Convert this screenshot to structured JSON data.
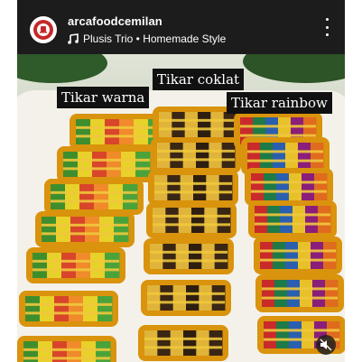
{
  "post": {
    "username": "arcafoodcemilan",
    "audio": "Plusis Trio • Homemade Style"
  },
  "captions": {
    "warna": "Tikar warna",
    "coklat": "Tikar coklat",
    "rainbow": "Tikar rainbow"
  },
  "icons": {
    "avatar": "restaurant-logo-icon",
    "music": "music-note-icon",
    "more": "more-vertical-icon",
    "mute": "muted-speaker-icon"
  },
  "colors": {
    "header_bg": "#1c1c1c",
    "caption_bg": "#111111",
    "tray": "#f4f1ea",
    "cake_edge": "#d9930c"
  }
}
